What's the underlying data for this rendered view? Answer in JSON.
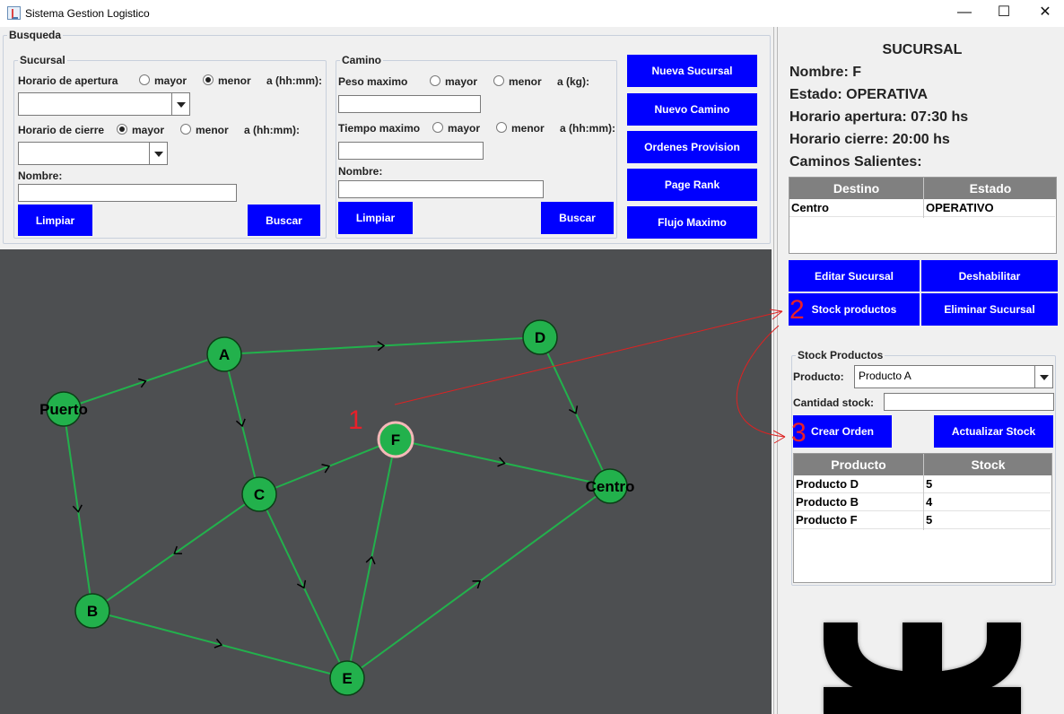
{
  "window": {
    "title": "Sistema Gestion Logistico",
    "minimize": "—",
    "maximize": "☐",
    "close": "✕"
  },
  "busqueda": {
    "legend": "Busqueda",
    "sucursal": {
      "legend": "Sucursal",
      "apertura_label": "Horario de apertura",
      "cierre_label": "Horario de cierre",
      "mayor": "mayor",
      "menor": "menor",
      "unit": "a (hh:mm):",
      "apertura_selected": "menor",
      "cierre_selected": "mayor",
      "nombre_label": "Nombre:",
      "limpiar": "Limpiar",
      "buscar": "Buscar"
    },
    "camino": {
      "legend": "Camino",
      "peso_label": "Peso maximo",
      "peso_unit": "a (kg):",
      "tiempo_label": "Tiempo maximo",
      "tiempo_unit": "a (hh:mm):",
      "mayor": "mayor",
      "menor": "menor",
      "nombre_label": "Nombre:",
      "limpiar": "Limpiar",
      "buscar": "Buscar"
    },
    "actions": [
      "Nueva Sucursal",
      "Nuevo Camino",
      "Ordenes Provision",
      "Page Rank",
      "Flujo Maximo"
    ]
  },
  "graph": {
    "node_color": "#22b14c",
    "selected_color": "#f4b8b8",
    "edge_color": "#22b14c",
    "nodes": [
      {
        "id": "Puerto"
      },
      {
        "id": "A"
      },
      {
        "id": "D"
      },
      {
        "id": "F",
        "selected": true
      },
      {
        "id": "C"
      },
      {
        "id": "Centro"
      },
      {
        "id": "B"
      },
      {
        "id": "E"
      }
    ],
    "edges": [
      [
        "Puerto",
        "A"
      ],
      [
        "A",
        "D"
      ],
      [
        "A",
        "C"
      ],
      [
        "D",
        "Centro"
      ],
      [
        "Puerto",
        "B"
      ],
      [
        "C",
        "F"
      ],
      [
        "F",
        "Centro"
      ],
      [
        "C",
        "B"
      ],
      [
        "C",
        "E"
      ],
      [
        "E",
        "F"
      ],
      [
        "B",
        "E"
      ],
      [
        "E",
        "Centro"
      ]
    ]
  },
  "annotations": {
    "one": "1",
    "two": "2",
    "three": "3",
    "color": "#e8202a"
  },
  "sucursal": {
    "header": "SUCURSAL",
    "nombre": "Nombre: F",
    "estado": "Estado: OPERATIVA",
    "apertura": "Horario apertura: 07:30 hs",
    "cierre": "Horario cierre: 20:00 hs",
    "caminos_label": "Caminos Salientes:",
    "caminos_columns": [
      "Destino",
      "Estado"
    ],
    "caminos_rows": [
      [
        "Centro",
        "OPERATIVO"
      ]
    ],
    "buttons": [
      "Editar Sucursal",
      "Deshabilitar",
      "Stock productos",
      "Eliminar Sucursal"
    ]
  },
  "stock": {
    "legend": "Stock Productos",
    "producto_label": "Producto:",
    "producto_value": "Producto A",
    "cantidad_label": "Cantidad stock:",
    "crear_orden": "Crear Orden",
    "actualizar": "Actualizar Stock",
    "columns": [
      "Producto",
      "Stock"
    ],
    "rows": [
      [
        "Producto D",
        "5"
      ],
      [
        "Producto B",
        "4"
      ],
      [
        "Producto F",
        "5"
      ]
    ]
  },
  "colors": {
    "button": "#0000ff",
    "graph_bg": "#4d4f51",
    "table_header": "#808080"
  }
}
